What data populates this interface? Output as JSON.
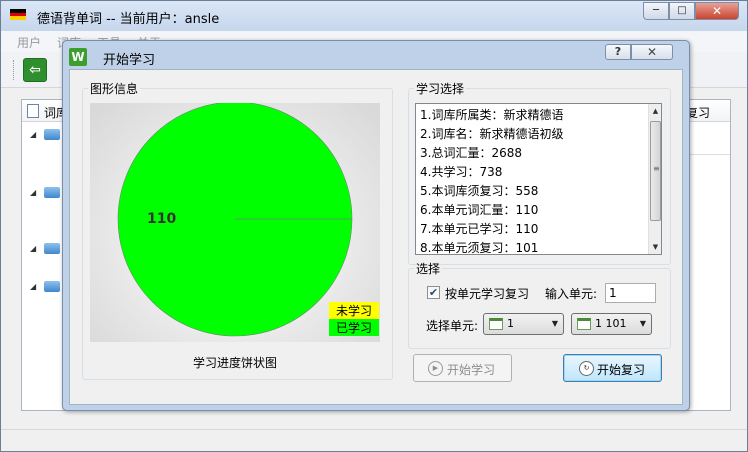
{
  "main_window": {
    "title": "德语背单词 -- 当前用户：ansle",
    "menu": [
      "用户",
      "词库",
      "工具",
      "关于"
    ],
    "tree_header_left": "词库",
    "tree_header_right": "复习",
    "caption_buttons": {
      "minimize": "─",
      "maximize": "□",
      "close": "✕"
    }
  },
  "dialog": {
    "title": "开始学习",
    "app_icon_letter": "W",
    "help_symbol": "?",
    "close_symbol": "✕",
    "chart_group_label": "图形信息",
    "chart_caption": "学习进度饼状图",
    "info_group_label": "学习选择",
    "info_lines": [
      "1.词库所属类：新求精德语",
      "2.词库名：新求精德语初级",
      "3.总词汇量：2688",
      "4.共学习：738",
      "5.本词库须复习：558",
      "6.本单元词汇量：110",
      "7.本单元已学习：110",
      "8.本单元须复习：101"
    ],
    "select_group_label": "选择",
    "review_checkbox_label": "按单元学习复习",
    "review_checked": true,
    "input_unit_label": "输入单元:",
    "input_unit_value": "1",
    "select_unit_label": "选择单元:",
    "combo_unit_value": "1",
    "combo_range_value": "1  101",
    "start_study_label": "开始学习",
    "start_review_label": "开始复习"
  },
  "chart_data": {
    "type": "pie",
    "categories": [
      "未学习",
      "已学习"
    ],
    "values": [
      0,
      110
    ],
    "colors": [
      "#ffff00",
      "#00ff00"
    ],
    "data_labels": [
      "110"
    ],
    "legend": "bottom-right",
    "title": ""
  }
}
